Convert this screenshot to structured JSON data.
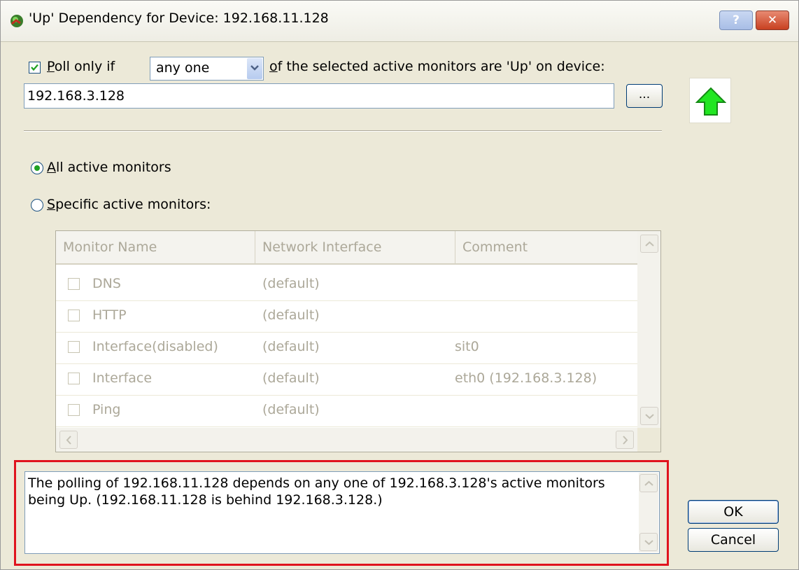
{
  "window": {
    "title": "'Up' Dependency for Device: 192.168.11.128",
    "help_label": "?",
    "close_label": "✕",
    "app_icon": "device-status-icon"
  },
  "poll": {
    "checkbox_checked": true,
    "prefix_label": "oll only if",
    "prefix_mnemonic": "P",
    "combo_value": "any one",
    "suffix_mnemonic": "o",
    "suffix_label": "f the selected active monitors are 'Up' on device:",
    "device_value": "192.168.3.128",
    "browse_label": "...",
    "status_icon": "up-arrow-icon",
    "status_color": "#22e622"
  },
  "scope": {
    "all_mnemonic": "A",
    "all_label": "ll active monitors",
    "all_selected": true,
    "specific_mnemonic": "S",
    "specific_label": "pecific active monitors:",
    "specific_selected": false
  },
  "monitors": {
    "columns": [
      "Monitor Name",
      "Network Interface",
      "Comment"
    ],
    "rows": [
      {
        "name": "DNS",
        "interface": "(default)",
        "comment": ""
      },
      {
        "name": "HTTP",
        "interface": "(default)",
        "comment": ""
      },
      {
        "name": "Interface(disabled)",
        "interface": "(default)",
        "comment": "sit0"
      },
      {
        "name": "Interface",
        "interface": "(default)",
        "comment": "eth0 (192.168.3.128)"
      },
      {
        "name": "Ping",
        "interface": "(default)",
        "comment": ""
      }
    ]
  },
  "description": {
    "text": "The polling of 192.168.11.128 depends on any one of 192.168.3.128's active monitors being Up.  (192.168.11.128 is behind 192.168.3.128.)",
    "highlight_color": "#e0141e"
  },
  "buttons": {
    "ok_label": "OK",
    "cancel_label": "Cancel"
  }
}
